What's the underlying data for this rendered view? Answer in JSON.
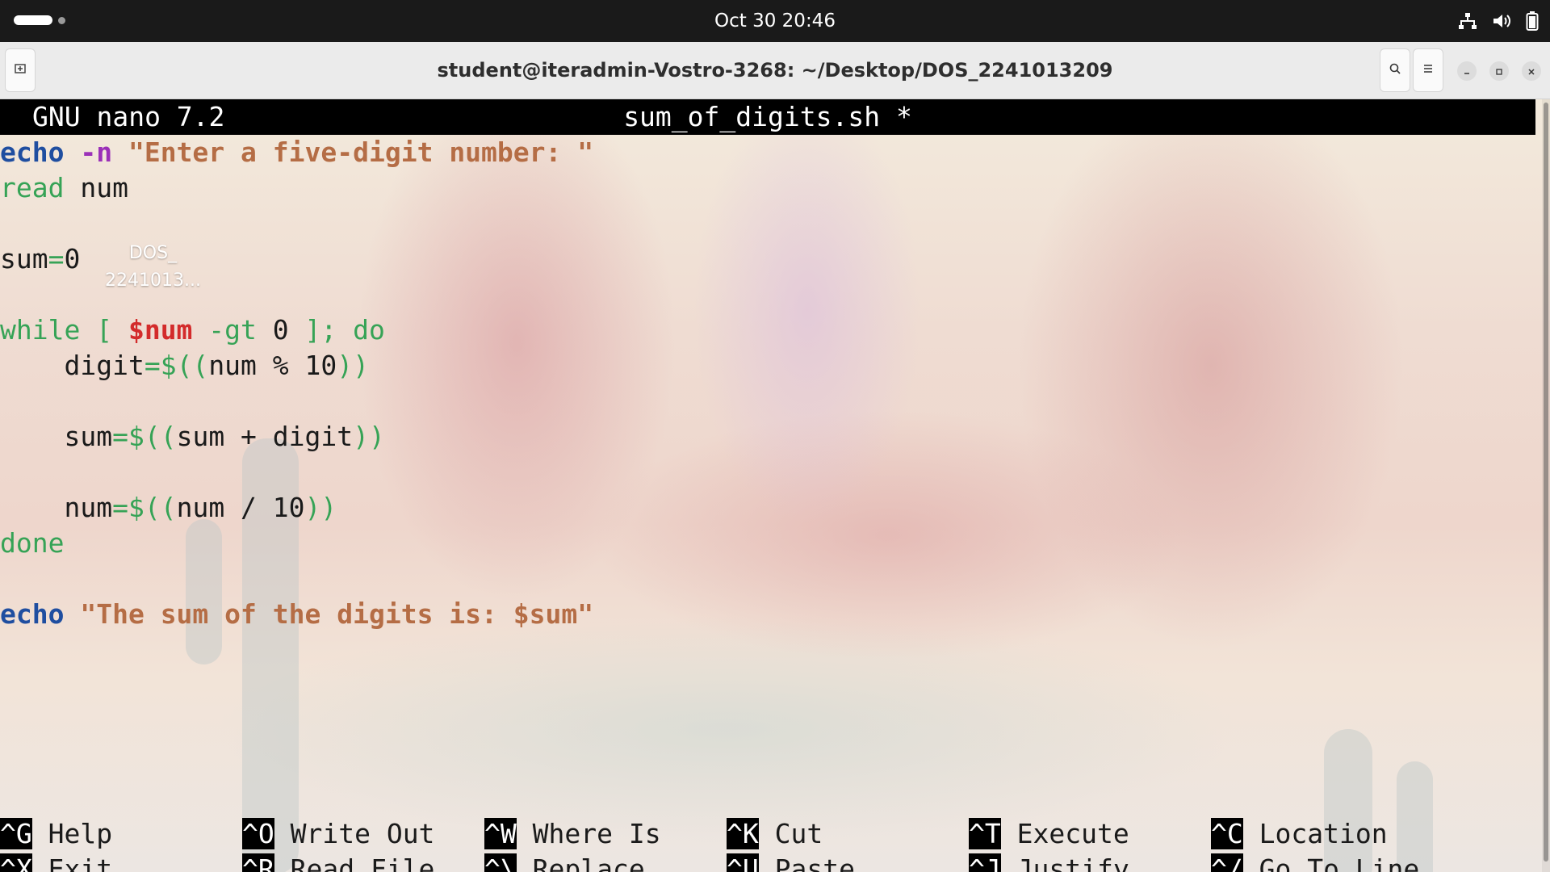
{
  "topbar": {
    "clock": "Oct 30  20:46",
    "icons": [
      "network-icon",
      "volume-icon",
      "battery-icon"
    ]
  },
  "window": {
    "title": "student@iteradmin-Vostro-3268: ~/Desktop/DOS_2241013209",
    "buttons": [
      "new-tab-icon",
      "search-icon",
      "menu-icon",
      "minimize-icon",
      "maximize-icon",
      "close-icon"
    ]
  },
  "nano": {
    "app": "GNU nano 7.2",
    "file": "sum_of_digits.sh *"
  },
  "code": {
    "l1": {
      "echo": "echo",
      "flag": " -n",
      "str": " \"Enter a five-digit number: \""
    },
    "l2": {
      "read": "read",
      "rest": " num"
    },
    "l4": {
      "var": "sum",
      "eq": "=",
      "val": "0"
    },
    "l6": {
      "while": "while",
      "br1": " [ ",
      "var": "$num",
      "op": " -gt ",
      "num": "0",
      "rest": " ]; do"
    },
    "l7": {
      "indent": "    ",
      "var": "digit",
      "open": "=$((",
      "expr": "num % 10",
      "close": "))"
    },
    "l9": {
      "indent": "    ",
      "var": "sum",
      "open": "=$((",
      "expr": "sum + digit",
      "close": "))"
    },
    "l11": {
      "indent": "    ",
      "var": "num",
      "open": "=$((",
      "expr": "num / 10",
      "close": "))"
    },
    "l12": {
      "done": "done"
    },
    "l14": {
      "echo": "echo",
      "str": " \"The sum of the digits is: $sum\""
    }
  },
  "desktop_icon": {
    "line1": "DOS_",
    "line2": "2241013..."
  },
  "shortcuts": [
    {
      "key": "^G",
      "label": " Help"
    },
    {
      "key": "^X",
      "label": " Exit"
    },
    {
      "key": "^O",
      "label": " Write Out"
    },
    {
      "key": "^R",
      "label": " Read File"
    },
    {
      "key": "^W",
      "label": " Where Is"
    },
    {
      "key": "^\\",
      "label": " Replace"
    },
    {
      "key": "^K",
      "label": " Cut"
    },
    {
      "key": "^U",
      "label": " Paste"
    },
    {
      "key": "^T",
      "label": " Execute"
    },
    {
      "key": "^J",
      "label": " Justify"
    },
    {
      "key": "^C",
      "label": " Location"
    },
    {
      "key": "^/",
      "label": " Go To Line"
    }
  ]
}
